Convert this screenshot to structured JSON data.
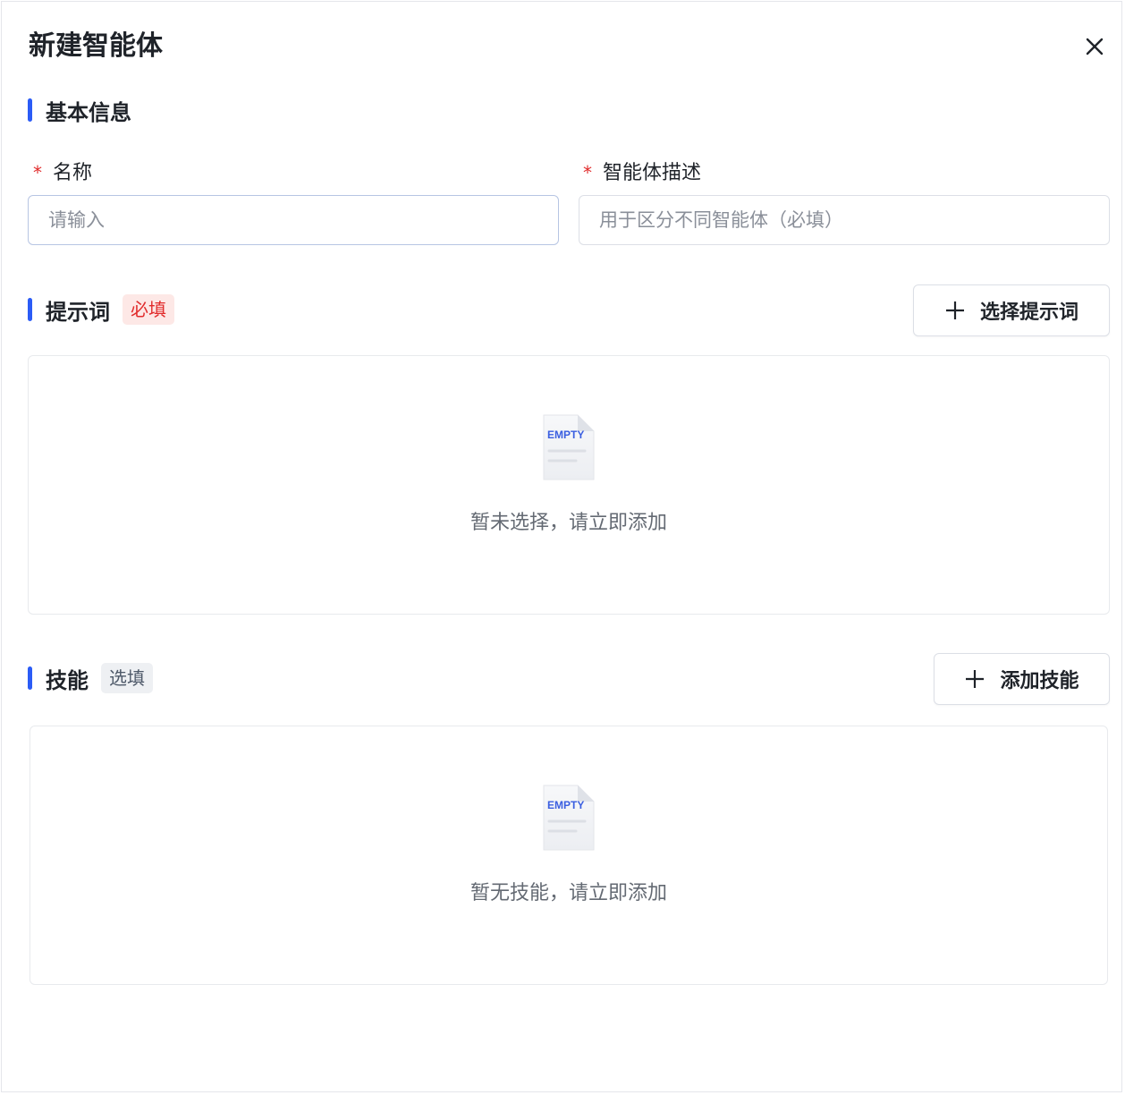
{
  "dialog": {
    "title": "新建智能体",
    "close_icon": "close-icon"
  },
  "basic_info": {
    "title": "基本信息",
    "name_field": {
      "required_mark": "*",
      "label": "名称",
      "placeholder": "请输入",
      "value": ""
    },
    "description_field": {
      "required_mark": "*",
      "label": "智能体描述",
      "placeholder": "用于区分不同智能体（必填）",
      "value": ""
    }
  },
  "prompt_section": {
    "title": "提示词",
    "tag": "必填",
    "action_label": "选择提示词",
    "empty_text": "暂未选择，请立即添加",
    "empty_icon_text": "EMPTY"
  },
  "skills_section": {
    "title": "技能",
    "tag": "选填",
    "action_label": "添加技能",
    "empty_text": "暂无技能，请立即添加",
    "empty_icon_text": "EMPTY"
  },
  "colors": {
    "accent": "#2b5cf6",
    "required_red": "#e12c2c",
    "required_tag_bg": "#fde8e6",
    "optional_tag_bg": "#eef0f3",
    "border": "#dcdfe6"
  }
}
